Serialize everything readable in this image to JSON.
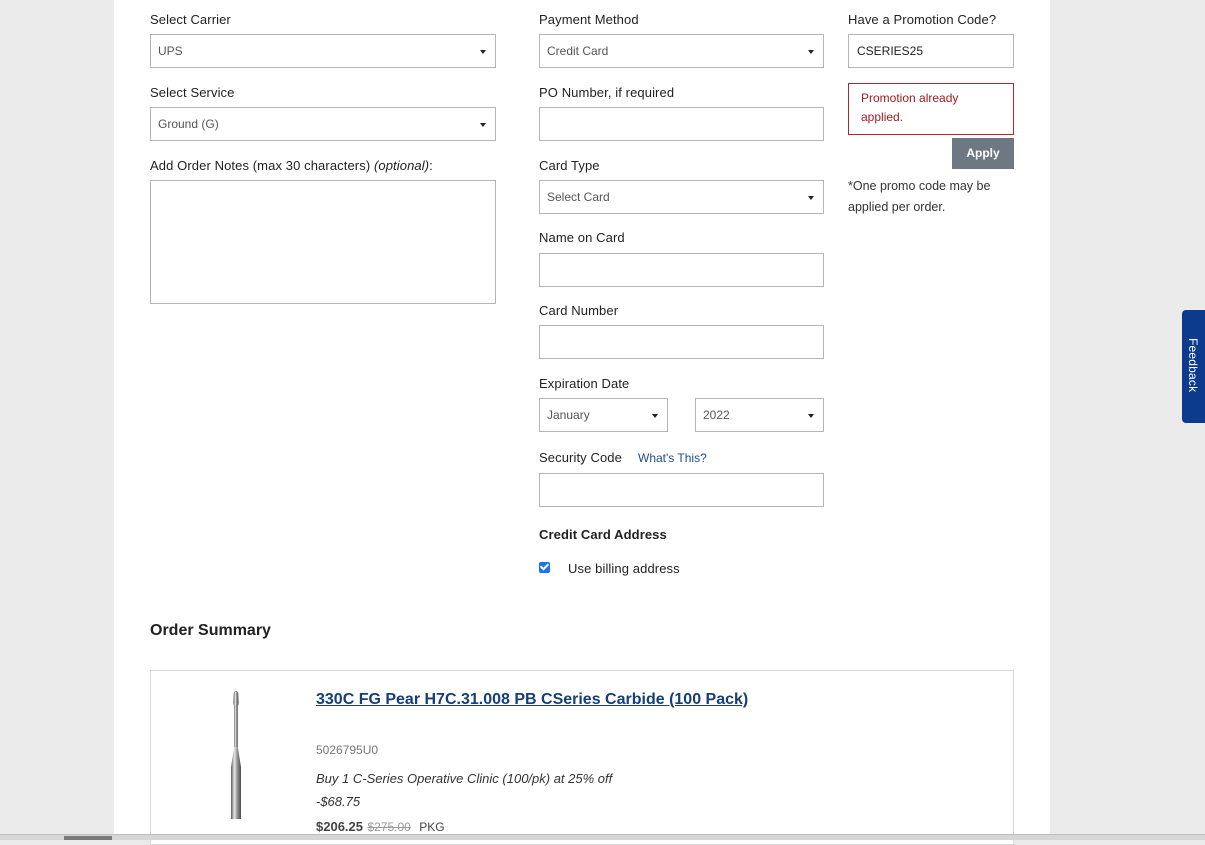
{
  "shipping": {
    "carrier_label": "Select Carrier",
    "carrier_value": "UPS",
    "service_label": "Select Service",
    "service_value": "Ground (G)",
    "notes_label": "Add Order Notes (max 30 characters)",
    "notes_optional": "(optional)",
    "notes_colon": ":"
  },
  "payment": {
    "method_label": "Payment Method",
    "method_value": "Credit Card",
    "po_label": "PO Number, if required",
    "card_type_label": "Card Type",
    "card_type_value": "Select Card",
    "name_label": "Name on Card",
    "number_label": "Card Number",
    "expiration_label": "Expiration Date",
    "exp_month_value": "January",
    "exp_year_value": "2022",
    "security_label": "Security Code",
    "whats_this": "What's This?",
    "cc_address_label": "Credit Card Address",
    "use_billing_label": "Use billing address",
    "use_billing_checked": true
  },
  "promo": {
    "label": "Have a Promotion Code?",
    "code_value": "CSERIES25",
    "error_text": "Promotion already applied.",
    "apply_label": "Apply",
    "note": "*One promo code may be applied per order."
  },
  "summary": {
    "title": "Order Summary",
    "item": {
      "title": "330C FG Pear H7C.31.008 PB CSeries Carbide (100 Pack)",
      "sku": "5026795U0",
      "promotion": "Buy 1 C-Series Operative Clinic (100/pk) at 25% off",
      "discount": "-$68.75",
      "price": "$206.25",
      "original_price": "$275.00",
      "unit": "PKG"
    }
  },
  "feedback": {
    "label": "Feedback"
  },
  "colors": {
    "apply_button": "#6d7883",
    "error": "#a31a1f",
    "link": "#163e78",
    "feedback_tab": "#0c3b8e",
    "checkbox": "#1a73e8"
  }
}
